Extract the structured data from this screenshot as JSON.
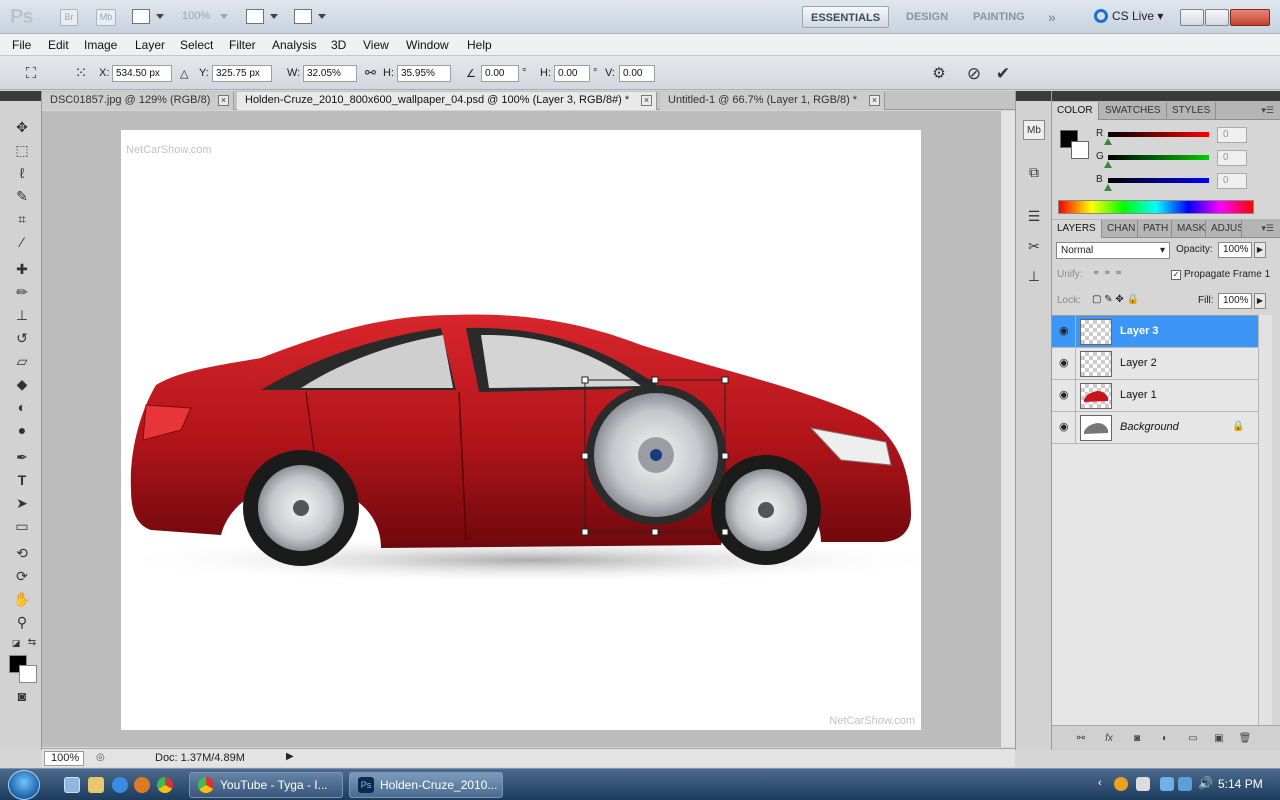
{
  "app": {
    "logo": "Ps",
    "bridge_label": "Br",
    "minibridge_label": "Mb",
    "zoom_value": "100%",
    "workspaces": [
      "ESSENTIALS",
      "DESIGN",
      "PAINTING"
    ],
    "workspaces_more": "»",
    "cs_live": "CS Live"
  },
  "menu": [
    "File",
    "Edit",
    "Image",
    "Layer",
    "Select",
    "Filter",
    "Analysis",
    "3D",
    "View",
    "Window",
    "Help"
  ],
  "options": {
    "x_label": "X:",
    "x_value": "534.50 px",
    "y_label": "Y:",
    "y_value": "325.75 px",
    "w_label": "W:",
    "w_value": "32.05%",
    "h_label": "H:",
    "h_value": "35.95%",
    "rot_value": "0.00",
    "rot_unit": "°",
    "hskew_label": "H:",
    "hskew_value": "0.00",
    "hskew_unit": "°",
    "vskew_label": "V:",
    "vskew_value": "0.00"
  },
  "tabs": [
    {
      "label": "DSC01857.jpg @ 129% (RGB/8)"
    },
    {
      "label": "Holden-Cruze_2010_800x600_wallpaper_04.psd @ 100% (Layer 3, RGB/8#) *"
    },
    {
      "label": "Untitled-1 @ 66.7% (Layer 1, RGB/8) *"
    }
  ],
  "canvas": {
    "watermark_top": "NetCarShow.com",
    "watermark_bottom": "NetCarShow.com"
  },
  "status": {
    "zoom": "100%",
    "doc": "Doc: 1.37M/4.89M"
  },
  "color_panel": {
    "tabs": [
      "COLOR",
      "SWATCHES",
      "STYLES"
    ],
    "r_label": "R",
    "g_label": "G",
    "b_label": "B",
    "r_value": "0",
    "g_value": "0",
    "b_value": "0"
  },
  "layers_panel": {
    "tabs": [
      "LAYERS",
      "CHAN",
      "PATH",
      "MASK",
      "ADJUS"
    ],
    "blend_mode": "Normal",
    "opacity_label": "Opacity:",
    "opacity_value": "100%",
    "unify_label": "Unify:",
    "propagate_label": "Propagate Frame 1",
    "lock_label": "Lock:",
    "fill_label": "Fill:",
    "fill_value": "100%",
    "layers": [
      {
        "name": "Layer 3"
      },
      {
        "name": "Layer 2"
      },
      {
        "name": "Layer 1"
      },
      {
        "name": "Background"
      }
    ]
  },
  "taskbar": {
    "buttons": [
      {
        "label": "YouTube - Tyga - I..."
      },
      {
        "label": "Holden-Cruze_2010..."
      }
    ],
    "clock": "5:14 PM"
  },
  "colors": {
    "selection_blue": "#3d95f5",
    "car_red": "#b5141a"
  }
}
